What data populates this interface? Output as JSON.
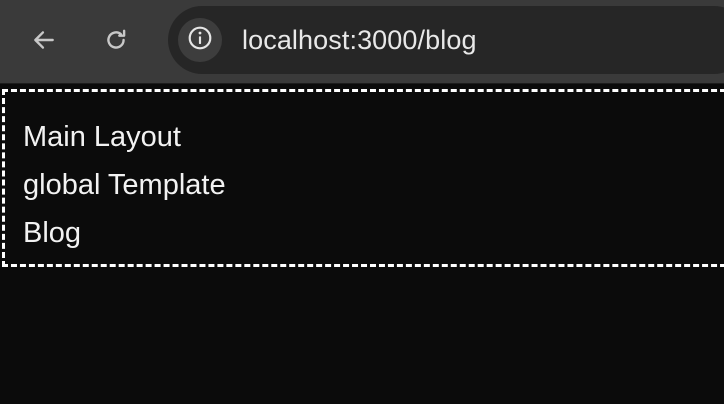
{
  "browser": {
    "back_icon": "arrow-left-icon",
    "reload_icon": "reload-icon",
    "site_info_icon": "info-icon",
    "url": "localhost:3000/blog"
  },
  "page": {
    "lines": [
      "Main Layout",
      "global Template",
      "Blog"
    ]
  },
  "colors": {
    "toolbar": "#3a3a3a",
    "omnibox": "#262626",
    "page_background": "#0b0b0b",
    "text": "#f2f2f2",
    "dashed_border": "#ffffff"
  }
}
